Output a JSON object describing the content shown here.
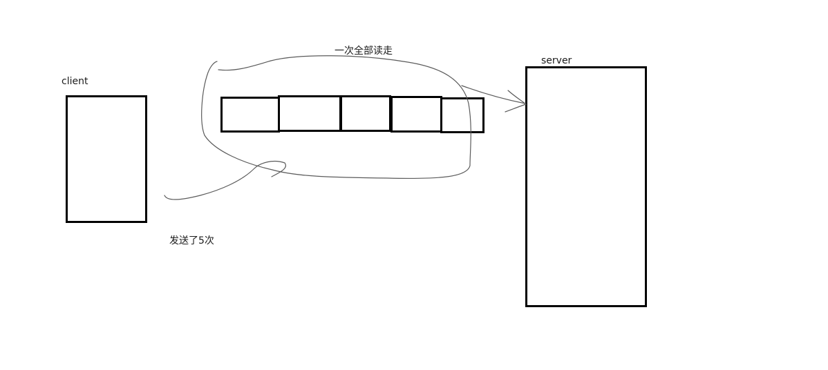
{
  "labels": {
    "client": "client",
    "server": "server",
    "read_all": "一次全部读走",
    "sent_times": "发送了5次"
  },
  "colors": {
    "box_stroke": "#000000",
    "sketch_stroke": "#5a5a5a",
    "text": "#1a1a1a"
  },
  "packets": {
    "count": 5
  }
}
